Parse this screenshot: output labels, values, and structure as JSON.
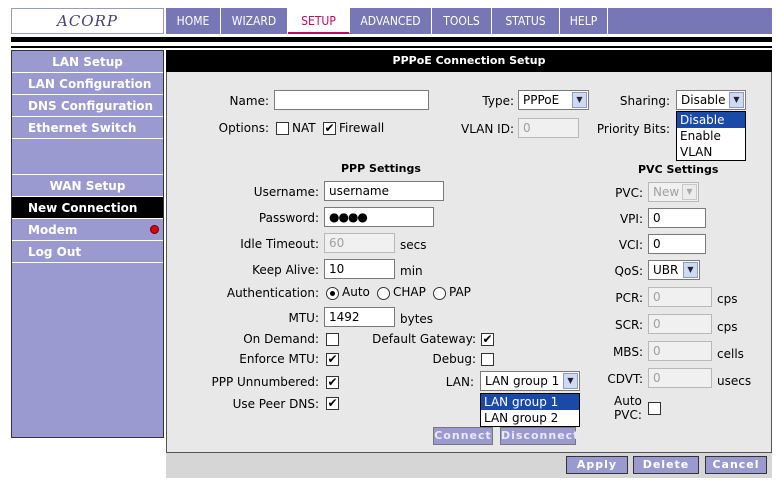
{
  "logo": {
    "text": "ACORP"
  },
  "nav": {
    "tabs": [
      {
        "label": "HOME"
      },
      {
        "label": "WIZARD"
      },
      {
        "label": "SETUP"
      },
      {
        "label": "ADVANCED"
      },
      {
        "label": "TOOLS"
      },
      {
        "label": "STATUS"
      },
      {
        "label": "HELP"
      }
    ],
    "active": "SETUP"
  },
  "sidebar": {
    "lan_header": "LAN Setup",
    "lan_items": [
      "LAN Configuration",
      "DNS Configuration",
      "Ethernet Switch"
    ],
    "wan_header": "WAN Setup",
    "wan_items": [
      "New Connection",
      "Modem",
      "Log Out"
    ],
    "selected": "New Connection"
  },
  "page": {
    "title": "PPPoE Connection Setup"
  },
  "form": {
    "name_label": "Name:",
    "name_value": "",
    "type_label": "Type:",
    "type_value": "PPPoE",
    "sharing_label": "Sharing:",
    "sharing_value": "Disable",
    "sharing_options": [
      "Disable",
      "Enable",
      "VLAN"
    ],
    "options_label": "Options:",
    "nat_label": "NAT",
    "nat_checked": false,
    "firewall_label": "Firewall",
    "firewall_checked": true,
    "vlan_label": "VLAN ID:",
    "vlan_value": "0",
    "priority_label": "Priority Bits:"
  },
  "ppp": {
    "title": "PPP Settings",
    "username_label": "Username:",
    "username_value": "username",
    "password_label": "Password:",
    "password_value": "●●●●",
    "idle_label": "Idle Timeout:",
    "idle_value": "60",
    "idle_unit": "secs",
    "keepalive_label": "Keep Alive:",
    "keepalive_value": "10",
    "keepalive_unit": "min",
    "auth_label": "Authentication:",
    "auth_options": [
      "Auto",
      "CHAP",
      "PAP"
    ],
    "auth_selected": "Auto",
    "mtu_label": "MTU:",
    "mtu_value": "1492",
    "mtu_unit": "bytes",
    "ondemand_label": "On Demand:",
    "ondemand_checked": false,
    "defgw_label": "Default Gateway:",
    "defgw_checked": true,
    "enforce_label": "Enforce MTU:",
    "enforce_checked": true,
    "debug_label": "Debug:",
    "debug_checked": false,
    "unnumbered_label": "PPP Unnumbered:",
    "unnumbered_checked": true,
    "lan_label": "LAN:",
    "lan_value": "LAN group 1",
    "lan_options": [
      "LAN group 1",
      "LAN group 2"
    ],
    "peerdns_label": "Use Peer DNS:",
    "peerdns_checked": true,
    "connect_label": "Connect",
    "disconnect_label": "Disconnect"
  },
  "pvc": {
    "title": "PVC Settings",
    "pvc_label": "PVC:",
    "pvc_value": "New",
    "vpi_label": "VPI:",
    "vpi_value": "0",
    "vci_label": "VCI:",
    "vci_value": "0",
    "qos_label": "QoS:",
    "qos_value": "UBR",
    "pcr_label": "PCR:",
    "pcr_value": "0",
    "pcr_unit": "cps",
    "scr_label": "SCR:",
    "scr_value": "0",
    "scr_unit": "cps",
    "mbs_label": "MBS:",
    "mbs_value": "0",
    "mbs_unit": "cells",
    "cdvt_label": "CDVT:",
    "cdvt_value": "0",
    "cdvt_unit": "usecs",
    "autopvc_label_1": "Auto",
    "autopvc_label_2": "PVC:",
    "autopvc_checked": false
  },
  "footer": {
    "apply": "Apply",
    "delete": "Delete",
    "cancel": "Cancel"
  },
  "colors": {
    "nav_bg": "#7777b5",
    "sidebar_bg": "#9a9ad0",
    "active_tab": "#c20a5c",
    "highlight": "#1a4aa8"
  }
}
